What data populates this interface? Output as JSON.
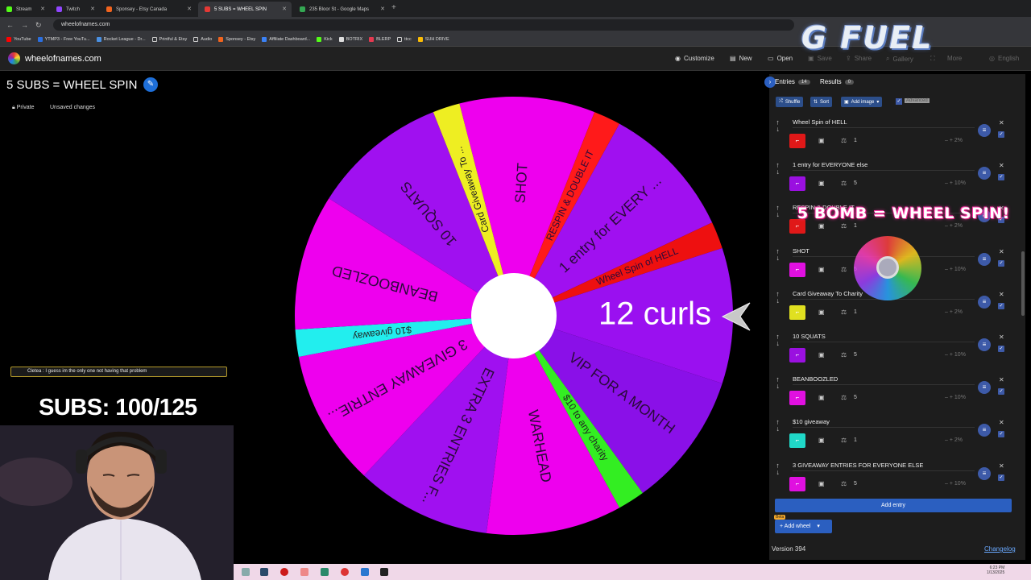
{
  "browser": {
    "tabs": [
      {
        "label": "Stream",
        "color": "#53fc18"
      },
      {
        "label": "Twitch",
        "color": "#9146ff"
      },
      {
        "label": "Sponsey - Etsy Canada",
        "color": "#f1641e"
      },
      {
        "label": "5 SUBS = WHEEL SPIN",
        "color": "#e53935"
      },
      {
        "label": "235 Bloor St - Google Maps",
        "color": "#34a853"
      }
    ],
    "url": "wheelofnames.com",
    "bookmarks": [
      "YouTube",
      "YTMP3 - Free YouTu...",
      "Rocket League - Dr...",
      "Printful & Etsy",
      "Audio",
      "Sponsey - Etsy",
      "Affiliate Dashboard...",
      "Kick",
      "BOTRIX",
      "BLERP",
      "ttcc",
      "SUH DRIVE"
    ]
  },
  "site": {
    "name": "wheelofnames.com",
    "menu": {
      "customize": "Customize",
      "new": "New",
      "open": "Open",
      "save": "Save",
      "share": "Share",
      "gallery": "Gallery",
      "more": "More",
      "language": "English"
    }
  },
  "wheel": {
    "title": "5 SUBS = WHEEL SPIN",
    "private_label": "Private",
    "unsaved_label": "Unsaved changes",
    "center_label": "12 curls",
    "segments": [
      {
        "label": "SHOT",
        "color": "#ee00ee"
      },
      {
        "label": "RESPIN & DOUBLE IT",
        "color": "#ff1a1a"
      },
      {
        "label": "1 entry for EVERY ...",
        "color": "#a010f0"
      },
      {
        "label": "Wheel Spin of HELL",
        "color": "#ee1010"
      },
      {
        "label": "12 curls",
        "color": "#9a10f0"
      },
      {
        "label": "VIP FOR A MONTH",
        "color": "#8a10e8"
      },
      {
        "label": "$10 to any charity",
        "color": "#33ee22"
      },
      {
        "label": "WARHEAD",
        "color": "#ee00ee"
      },
      {
        "label": "EXTRA 3 ENTRIES F...",
        "color": "#a010f0"
      },
      {
        "label": "3 GIVEAWAY ENTRIE...",
        "color": "#ee00ee"
      },
      {
        "label": "$10 giveaway",
        "color": "#22eeee"
      },
      {
        "label": "BEANBOOZLED",
        "color": "#ee00ee"
      },
      {
        "label": "10 SQUATS",
        "color": "#a010f0"
      },
      {
        "label": "Card Giveaway To ...",
        "color": "#eeee22"
      }
    ]
  },
  "stream": {
    "chat_message": "Cletea : I guess im the only one not having that problem",
    "subs_text": "SUBS: 100/125",
    "sponsor_logo": "G FUEL",
    "alert_text": "5 BOMB = WHEEL SPIN!"
  },
  "panel": {
    "tab_entries": "Entries",
    "entries_count": "14",
    "tab_results": "Results",
    "results_count": "0",
    "shuffle": "Shuffle",
    "sort": "Sort",
    "add_image": "Add image",
    "advanced": "Advanced",
    "entries": [
      {
        "text": "Wheel Spin of HELL",
        "color": "#e01818",
        "weight": "1",
        "pct": "2%"
      },
      {
        "text": "1 entry for EVERYONE else",
        "color": "#9a10e0",
        "weight": "5",
        "pct": "10%"
      },
      {
        "text": "RESPIN & DOUBLE IT",
        "color": "#e01818",
        "weight": "1",
        "pct": "2%"
      },
      {
        "text": "SHOT",
        "color": "#e010e0",
        "weight": "5",
        "pct": "10%"
      },
      {
        "text": "Card Giveaway To Charity",
        "color": "#e0e020",
        "weight": "1",
        "pct": "2%"
      },
      {
        "text": "10 SQUATS",
        "color": "#9a10e0",
        "weight": "5",
        "pct": "10%"
      },
      {
        "text": "BEANBOOZLED",
        "color": "#e010e0",
        "weight": "5",
        "pct": "10%"
      },
      {
        "text": "$10 giveaway",
        "color": "#20d8c8",
        "weight": "1",
        "pct": "2%"
      },
      {
        "text": "3 GIVEAWAY ENTRIES FOR EVERYONE ELSE",
        "color": "#e010e0",
        "weight": "5",
        "pct": "10%"
      }
    ],
    "add_entry": "Add entry",
    "add_wheel": "Add wheel",
    "beta": "Beta",
    "version": "Version 394",
    "changelog": "Changelog"
  },
  "taskbar": {
    "time": "6:23 PM",
    "date": "1/13/2025"
  }
}
